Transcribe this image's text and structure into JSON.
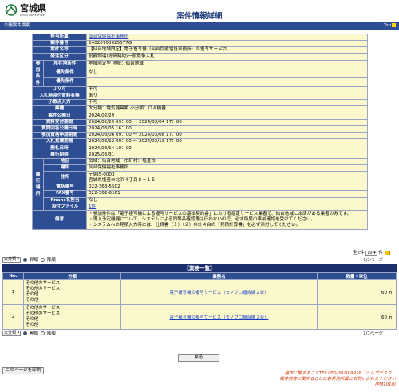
{
  "header": {
    "logo_text": "宮城県",
    "logo_sub": "MIYAGI PREFECTURE",
    "title": "案件情報詳細"
  },
  "bar": {
    "label": "公開案件検索",
    "top_link": "Top"
  },
  "details": {
    "tantou_label": "担当所属",
    "tantou_value": "仙台保健福祉事務所",
    "bango_label": "案件番号",
    "bango_value": "24020700025577G",
    "name_label": "案件名称",
    "name_value": "【仙台地域限定】電子複写機（仙台保健福祉事務所）の複写サービス",
    "hatchu_label": "発注区分",
    "hatchu_value": "役務調達(総価契約)一般競争入札",
    "sanka_group": "参加条件",
    "shozai_label": "所在地条件",
    "shozai_value": "地域限定型 地域：仙台地域",
    "yusen_label": "優先条件",
    "yusen_value": "なし",
    "yusen2_label": "優先条件",
    "yusen2_value": "",
    "jv_label": "ＪＶ可",
    "jv_value": "不可",
    "nyusatsu_label": "入札時添付資料有無",
    "nyusatsu_value": "あり",
    "kosu_label": "小数点入力",
    "kosu_value": "不可",
    "gyoshu_label": "業種",
    "gyoshu_value": "大分類：電気器具類 小分類：ＯＡ機器",
    "kokai_label": "案件公開日",
    "kokai_value": "2024/02/29",
    "shiryo_label": "資料受付期間",
    "shiryo_value": "2024/02/29 09：00 ～ 2024/03/04 17：00",
    "shitsumon_label": "質問回答公開日時",
    "shitsumon_value": "2024/03/05 16：00",
    "shinsei_label": "参加資格申請期間",
    "shinsei_value": "2024/03/06 09：00 ～ 2024/03/08 17：00",
    "uketsuke_label": "入札見積期間",
    "uketsuke_value": "2024/03/12 09：00 ～ 2024/03/13 17：00",
    "kaisatsu_label": "開札日時",
    "kaisatsu_value": "2024/03/14 10：00",
    "rikou_label": "履行期限",
    "rikou_value": "2025/03/31",
    "basho_group": "履行場所",
    "chiiki_label": "地区",
    "chiiki_value": "広域：仙台地域　市町村：塩釜市",
    "bs_label": "場所",
    "bs_value": "仙台保健福祉事務所",
    "jusho_label": "住所",
    "jusho_value1": "〒985-0003",
    "jusho_value2": "宮城県塩釜市北浜４丁目８－１５",
    "tel_label": "電話番号",
    "tel_value": "022-363-5502",
    "fax_label": "FAX番号",
    "fax_value": "022-362-6161",
    "tanto_label": "financ名担当",
    "tanto_value": "なし",
    "tenpu_label": "添付ファイル",
    "tenpu_value": "1件",
    "biko_label": "備考",
    "biko_1": "・参加条件は「電子複写機による複写サービスの基本契約書」における指定サービス業者で、仙台地域に本店がある業者のみです。",
    "biko_2": "・導入予定機器について、システムによる同等品確認等は行わないので、必ず所属の事前確認を受けてください。",
    "biko_3": "・システムへの見積入力時には、仕様書（１）（２）の計４台の「見積計算書」を必ず添付してください。"
  },
  "pager": {
    "total": "全2件",
    "per_page": "10",
    "per_page_unit": "件",
    "sort": "大分類",
    "asc": "昇順",
    "desc": "降順",
    "pages": "1/1ページ"
  },
  "list": {
    "title": "【業務一覧】",
    "col_no": "No.",
    "col_cat": "分類",
    "col_name": "業務名",
    "col_qty": "数量・単位",
    "rows": [
      {
        "no": "1",
        "cat1": "その他のサービス",
        "cat2": "その他のサービス",
        "cat3": "その他",
        "cat4": "その他",
        "name": "電子複写機の複写サービス（モノクロ複合機２台）",
        "qty": "60 ｎ"
      },
      {
        "no": "2",
        "cat1": "その他のサービス",
        "cat2": "その他のサービス",
        "cat3": "その他",
        "cat4": "その他",
        "name": "電子複写機の複写サービス（モノクロ複合機２台）",
        "qty": "60 ｎ"
      }
    ]
  },
  "buttons": {
    "back": "戻る",
    "print": "このページを印刷"
  },
  "footer": {
    "line1": "操作に関することTEL:050-3820-9928（ヘルプデスク）",
    "line2": "案件内容に関することは各発注所属にお問い合わせください",
    "line3": "(PM1010)"
  }
}
